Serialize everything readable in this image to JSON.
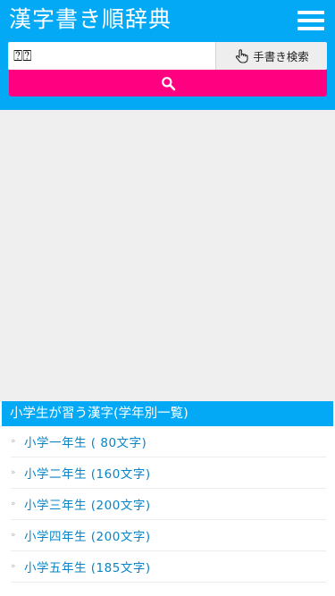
{
  "header": {
    "title": "漢字書き順辞典",
    "menu_icon": "hamburger-menu-icon",
    "background": "#03a9f4"
  },
  "search": {
    "value": "⍰⍰",
    "handwriting_label": "手書き検索",
    "handwriting_icon": "pointing-hand-icon",
    "submit_icon": "search-icon",
    "submit_color": "#ff0080"
  },
  "grade_list": {
    "heading": "小学生が習う漢字(学年別一覧)",
    "items": [
      {
        "label": "小学一年生 ( 80文字)"
      },
      {
        "label": "小学二年生 (160文字)"
      },
      {
        "label": "小学三年生 (200文字)"
      },
      {
        "label": "小学四年生 (200文字)"
      },
      {
        "label": "小学五年生 (185文字)"
      }
    ],
    "link_color": "#0a84c6"
  }
}
